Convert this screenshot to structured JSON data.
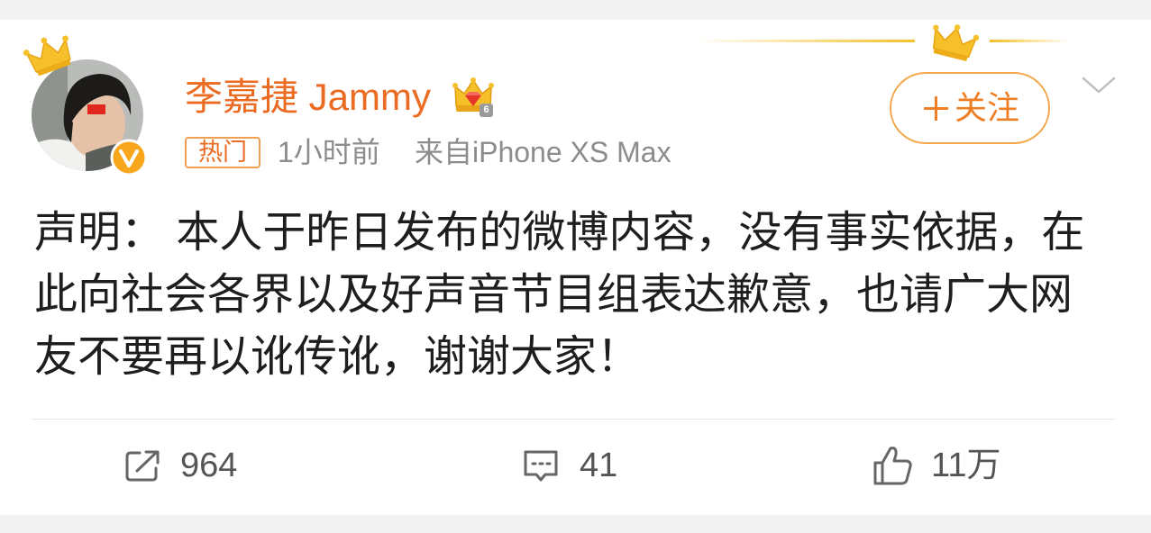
{
  "colors": {
    "page_bg": "#f2f2f2",
    "card_bg": "#ffffff",
    "accent_orange": "#ea6b21",
    "tag_orange": "#f0a050",
    "follow_border": "#f4a64a",
    "follow_text": "#ee7f26",
    "meta_gray": "#8c8c8c",
    "text": "#1e1e1e",
    "action_gray": "#555555",
    "verified_yellow": "#f8a61c",
    "crown_gold": "#f6c02b"
  },
  "author": {
    "name": "李嘉捷 Jammy",
    "avatar": "avatar-photo",
    "avatar_crown_icon": "crown-icon",
    "verified_icon": "verified-v-icon",
    "member_badge_icon": "vip-crown-badge-icon",
    "member_level": "6"
  },
  "meta": {
    "tag": "热门",
    "time": "1小时前",
    "source": "来自iPhone XS Max"
  },
  "header": {
    "decoration_icon": "crown-icon",
    "follow_icon": "plus-icon",
    "follow_label": "关注",
    "menu_icon": "chevron-down-icon"
  },
  "post": {
    "lines": [
      "声明： 本人于昨日发布的微博内容，没有事实依据，在",
      "此向社会各界以及好声音节目组表达歉意，也请广大网",
      "友不要再以讹传讹，谢谢大家！"
    ]
  },
  "actions": [
    {
      "name": "repost",
      "icon": "share-icon",
      "count": "964"
    },
    {
      "name": "comment",
      "icon": "comment-icon",
      "count": "41"
    },
    {
      "name": "like",
      "icon": "like-icon",
      "count": "11万"
    }
  ]
}
